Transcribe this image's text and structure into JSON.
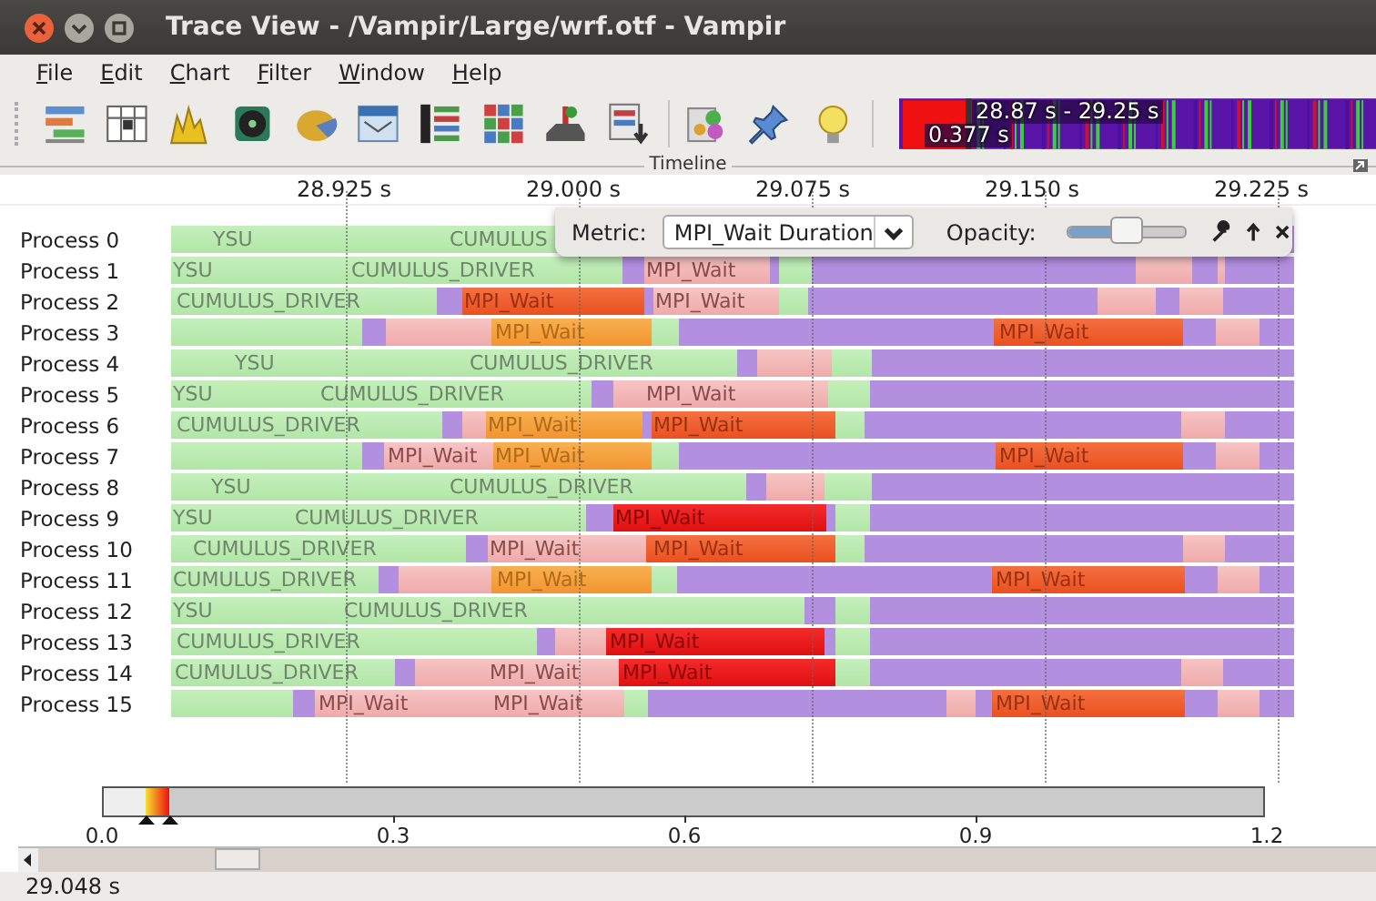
{
  "window": {
    "title": "Trace View - /Vampir/Large/wrf.otf - Vampir"
  },
  "menu": [
    "File",
    "Edit",
    "Chart",
    "Filter",
    "Window",
    "Help"
  ],
  "toolbar": {
    "overview": {
      "range": "28.87 s - 29.25 s",
      "duration": "0.377 s"
    }
  },
  "timeline": {
    "title": "Timeline",
    "axis": [
      "28.925 s",
      "29.000 s",
      "29.075 s",
      "29.150 s",
      "29.225 s"
    ],
    "metric_popup": {
      "label": "Metric:",
      "value": "MPI_Wait Duration",
      "opacity_label": "Opacity:",
      "opacity": {
        "level": 0.5
      }
    },
    "processes": [
      {
        "name": "Process 0",
        "segments": [
          {
            "kind": "compute",
            "label": "YSU"
          },
          {
            "kind": "compute",
            "label": "CUMULUS"
          },
          {
            "kind": "mpi"
          }
        ]
      },
      {
        "name": "Process 1",
        "segments": [
          {
            "kind": "compute",
            "label": "YSU"
          },
          {
            "kind": "compute",
            "label": "CUMULUS_DRIVER"
          },
          {
            "kind": "mpi"
          },
          {
            "kind": "wait-light",
            "label": "MPI_Wait"
          },
          {
            "kind": "mpi"
          },
          {
            "kind": "compute"
          },
          {
            "kind": "mpi"
          },
          {
            "kind": "wait-light"
          },
          {
            "kind": "mpi"
          },
          {
            "kind": "wait-light"
          },
          {
            "kind": "mpi"
          }
        ]
      },
      {
        "name": "Process 2",
        "segments": [
          {
            "kind": "compute",
            "label": "CUMULUS_DRIVER"
          },
          {
            "kind": "mpi"
          },
          {
            "kind": "wait-deep",
            "label": "MPI_Wait"
          },
          {
            "kind": "mpi"
          },
          {
            "kind": "wait-light",
            "label": "MPI_Wait"
          },
          {
            "kind": "compute"
          },
          {
            "kind": "mpi"
          },
          {
            "kind": "wait-light"
          },
          {
            "kind": "mpi"
          },
          {
            "kind": "wait-light"
          },
          {
            "kind": "mpi"
          }
        ]
      },
      {
        "name": "Process 3",
        "segments": [
          {
            "kind": "compute"
          },
          {
            "kind": "mpi"
          },
          {
            "kind": "wait-light"
          },
          {
            "kind": "wait-orange",
            "label": "MPI_Wait"
          },
          {
            "kind": "compute"
          },
          {
            "kind": "mpi"
          },
          {
            "kind": "wait-deep",
            "label": "MPI_Wait"
          },
          {
            "kind": "mpi"
          },
          {
            "kind": "wait-light"
          },
          {
            "kind": "mpi"
          }
        ]
      },
      {
        "name": "Process 4",
        "segments": [
          {
            "kind": "compute",
            "label": "YSU"
          },
          {
            "kind": "compute",
            "label": "CUMULUS_DRIVER"
          },
          {
            "kind": "mpi"
          },
          {
            "kind": "wait-light"
          },
          {
            "kind": "compute"
          },
          {
            "kind": "mpi"
          }
        ]
      },
      {
        "name": "Process 5",
        "segments": [
          {
            "kind": "compute",
            "label": "YSU"
          },
          {
            "kind": "compute",
            "label": "CUMULUS_DRIVER"
          },
          {
            "kind": "mpi"
          },
          {
            "kind": "wait-light",
            "label": "MPI_Wait"
          },
          {
            "kind": "compute"
          },
          {
            "kind": "mpi"
          }
        ]
      },
      {
        "name": "Process 6",
        "segments": [
          {
            "kind": "compute",
            "label": "CUMULUS_DRIVER"
          },
          {
            "kind": "mpi"
          },
          {
            "kind": "wait-light"
          },
          {
            "kind": "wait-orange",
            "label": "MPI_Wait"
          },
          {
            "kind": "mpi"
          },
          {
            "kind": "wait-deep",
            "label": "MPI_Wait"
          },
          {
            "kind": "compute"
          },
          {
            "kind": "mpi"
          },
          {
            "kind": "wait-light"
          },
          {
            "kind": "mpi"
          }
        ]
      },
      {
        "name": "Process 7",
        "segments": [
          {
            "kind": "compute"
          },
          {
            "kind": "mpi"
          },
          {
            "kind": "wait-light",
            "label": "MPI_Wait"
          },
          {
            "kind": "wait-orange",
            "label": "MPI_Wait"
          },
          {
            "kind": "compute"
          },
          {
            "kind": "mpi"
          },
          {
            "kind": "wait-deep",
            "label": "MPI_Wait"
          },
          {
            "kind": "mpi"
          },
          {
            "kind": "wait-light"
          },
          {
            "kind": "mpi"
          }
        ]
      },
      {
        "name": "Process 8",
        "segments": [
          {
            "kind": "compute",
            "label": "YSU"
          },
          {
            "kind": "compute",
            "label": "CUMULUS_DRIVER"
          },
          {
            "kind": "mpi"
          },
          {
            "kind": "wait-light"
          },
          {
            "kind": "compute"
          },
          {
            "kind": "mpi"
          }
        ]
      },
      {
        "name": "Process 9",
        "segments": [
          {
            "kind": "compute",
            "label": "YSU"
          },
          {
            "kind": "compute",
            "label": "CUMULUS_DRIVER"
          },
          {
            "kind": "mpi"
          },
          {
            "kind": "wait-red",
            "label": "MPI_Wait"
          },
          {
            "kind": "mpi"
          },
          {
            "kind": "compute"
          },
          {
            "kind": "mpi"
          }
        ]
      },
      {
        "name": "Process 10",
        "segments": [
          {
            "kind": "compute",
            "label": "CUMULUS_DRIVER"
          },
          {
            "kind": "mpi"
          },
          {
            "kind": "wait-light",
            "label": "MPI_Wait"
          },
          {
            "kind": "wait-deep",
            "label": "MPI_Wait"
          },
          {
            "kind": "compute"
          },
          {
            "kind": "mpi"
          },
          {
            "kind": "wait-light"
          },
          {
            "kind": "mpi"
          }
        ]
      },
      {
        "name": "Process 11",
        "segments": [
          {
            "kind": "compute",
            "label": "CUMULUS_DRIVER"
          },
          {
            "kind": "mpi"
          },
          {
            "kind": "wait-light"
          },
          {
            "kind": "wait-orange",
            "label": "MPI_Wait"
          },
          {
            "kind": "compute"
          },
          {
            "kind": "mpi"
          },
          {
            "kind": "wait-deep",
            "label": "MPI_Wait"
          },
          {
            "kind": "mpi"
          },
          {
            "kind": "wait-light"
          },
          {
            "kind": "mpi"
          }
        ]
      },
      {
        "name": "Process 12",
        "segments": [
          {
            "kind": "compute",
            "label": "YSU"
          },
          {
            "kind": "compute",
            "label": "CUMULUS_DRIVER"
          },
          {
            "kind": "mpi"
          },
          {
            "kind": "compute"
          },
          {
            "kind": "mpi"
          }
        ]
      },
      {
        "name": "Process 13",
        "segments": [
          {
            "kind": "compute",
            "label": "CUMULUS_DRIVER"
          },
          {
            "kind": "mpi"
          },
          {
            "kind": "wait-light"
          },
          {
            "kind": "wait-red",
            "label": "MPI_Wait"
          },
          {
            "kind": "mpi"
          },
          {
            "kind": "compute"
          },
          {
            "kind": "mpi"
          }
        ]
      },
      {
        "name": "Process 14",
        "segments": [
          {
            "kind": "compute",
            "label": "CUMULUS_DRIVER"
          },
          {
            "kind": "mpi"
          },
          {
            "kind": "wait-light",
            "label": "MPI_Wait"
          },
          {
            "kind": "wait-red",
            "label": "MPI_Wait"
          },
          {
            "kind": "compute"
          },
          {
            "kind": "mpi"
          },
          {
            "kind": "wait-light"
          },
          {
            "kind": "mpi"
          }
        ]
      },
      {
        "name": "Process 15",
        "segments": [
          {
            "kind": "compute"
          },
          {
            "kind": "mpi"
          },
          {
            "kind": "wait-light",
            "label": "MPI_Wait"
          },
          {
            "kind": "wait-light",
            "label": "MPI_Wait"
          },
          {
            "kind": "compute"
          },
          {
            "kind": "mpi"
          },
          {
            "kind": "wait-light"
          },
          {
            "kind": "mpi"
          },
          {
            "kind": "wait-deep",
            "label": "MPI_Wait"
          },
          {
            "kind": "mpi"
          },
          {
            "kind": "wait-light"
          },
          {
            "kind": "mpi"
          }
        ]
      }
    ]
  },
  "color_scale": {
    "ticks": [
      "0.0",
      "0.3",
      "0.6",
      "0.9",
      "1.2"
    ]
  },
  "status_bar": "29.048 s"
}
